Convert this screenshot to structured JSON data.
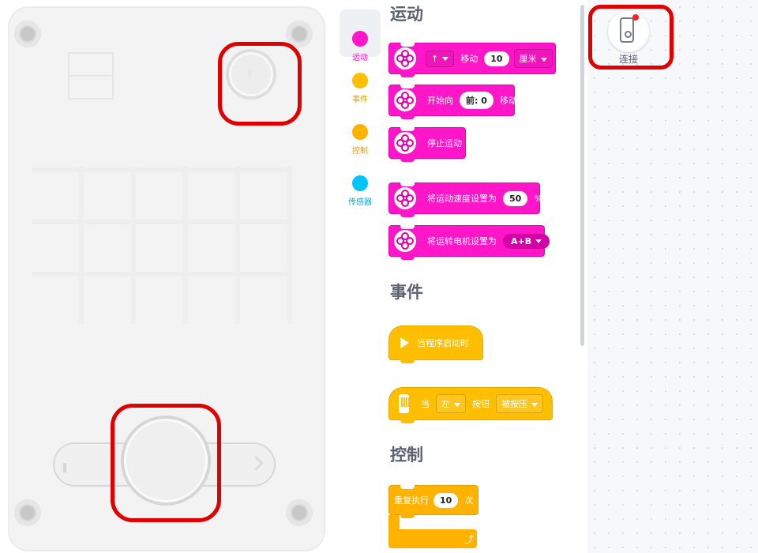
{
  "hub": {
    "bluetooth_glyph": "ᛒ"
  },
  "categories": [
    {
      "label": "运动",
      "color": "#ff16c8",
      "active": true
    },
    {
      "label": "事件",
      "color": "#ffbf00",
      "active": false
    },
    {
      "label": "控制",
      "color": "#ffb300",
      "active": false
    },
    {
      "label": "传感器",
      "color": "#00c4f5",
      "active": false
    }
  ],
  "sections": {
    "motion": "运动",
    "events": "事件",
    "control": "控制"
  },
  "blocks": {
    "move": {
      "direction": "↑",
      "label": "移动",
      "amount": "10",
      "unit": "厘米"
    },
    "start_move": {
      "label_before": "开始向",
      "value": "前: 0",
      "label_after": "移动"
    },
    "stop": {
      "label": "停止运动"
    },
    "set_speed": {
      "label": "将运动速度设置为",
      "value": "50",
      "unit": "%"
    },
    "set_motors": {
      "label": "将运转电机设置为",
      "value": "A+B"
    },
    "when_start": {
      "label": "当程序启动时"
    },
    "when_button": {
      "label_when": "当",
      "side": "左",
      "label_button": "按钮",
      "state": "被按压"
    },
    "repeat": {
      "label": "重复执行",
      "count": "10",
      "unit": "次",
      "end_glyph": "⤴"
    }
  },
  "workspace": {
    "connect_label": "连接"
  },
  "colors": {
    "highlight": "#e00000",
    "motion": "#ff16c8",
    "event": "#ffbf00",
    "control": "#ffb300",
    "sensor": "#00c4f5"
  }
}
